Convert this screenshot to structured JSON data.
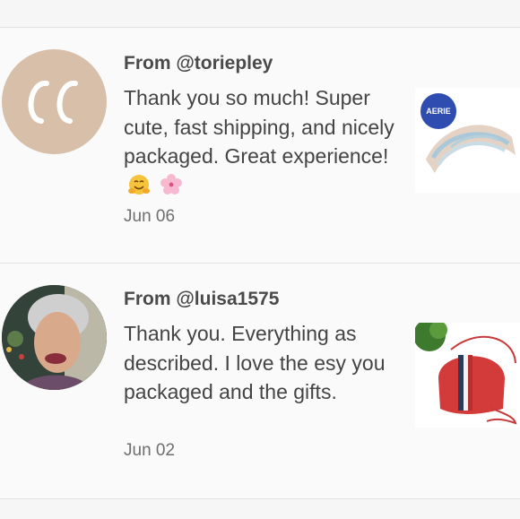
{
  "reviews": [
    {
      "from": "From @toriepley",
      "message": "Thank you so much! Super cute, fast shipping, and nicely packaged. Great experience!",
      "emojis": [
        "hugging-face-emoji",
        "cherry-blossom-emoji"
      ],
      "date": "Jun 06",
      "avatar_initials": "CC",
      "product_badge": "AERIE",
      "product_icon": "headband-photo"
    },
    {
      "from": "From @luisa1575",
      "message": "Thank you. Everything as described. I love the esy you packaged and the gifts.",
      "date": "Jun 02",
      "avatar_icon": "profile-photo",
      "product_icon": "red-crossbody-bag-photo"
    }
  ],
  "colors": {
    "avatar_bg": "#d7bfa9",
    "badge": "#2f4cb0",
    "bag_red": "#d33a3a"
  }
}
